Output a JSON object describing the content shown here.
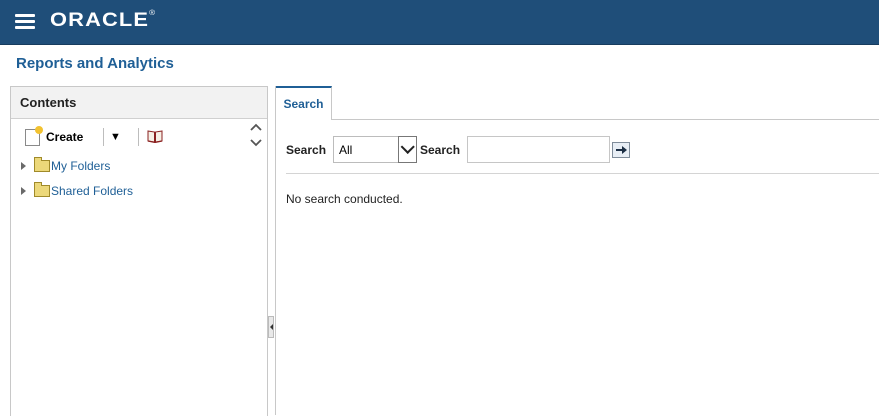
{
  "header": {
    "logo": "ORACLE",
    "logo_mark": "®"
  },
  "page": {
    "title": "Reports and Analytics"
  },
  "left_panel": {
    "title": "Contents",
    "toolbar": {
      "create_label": "Create"
    },
    "tree": [
      {
        "label": "My Folders"
      },
      {
        "label": "Shared Folders"
      }
    ]
  },
  "right_panel": {
    "tabs": [
      {
        "label": "Search"
      }
    ],
    "search": {
      "scope_label": "Search",
      "scope_value": "All",
      "text_label": "Search",
      "text_value": ""
    },
    "status": "No search conducted."
  },
  "colors": {
    "header_bg": "#1f4e79",
    "link": "#1f5f96"
  }
}
